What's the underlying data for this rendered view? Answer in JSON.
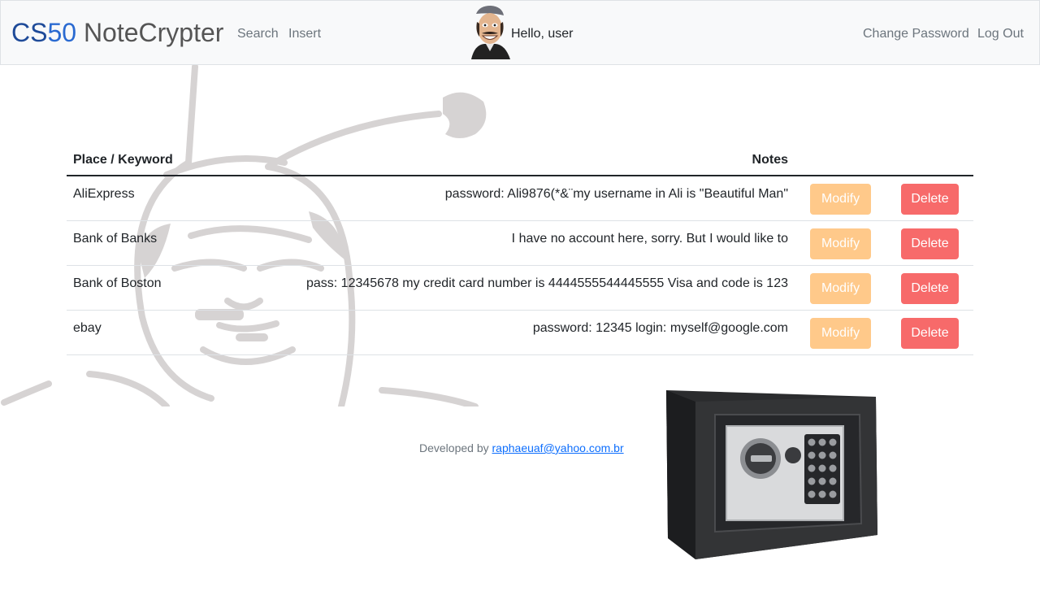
{
  "navbar": {
    "brand_cs": "CS",
    "brand_fifty": "50",
    "brand_rest": " NoteCrypter",
    "links": {
      "search": "Search",
      "insert": "Insert",
      "change_password": "Change Password",
      "logout": "Log Out"
    },
    "greeting": "Hello, user"
  },
  "table": {
    "headers": {
      "place": "Place / Keyword",
      "notes": "Notes"
    },
    "rows": [
      {
        "place": "AliExpress",
        "note": "password: Ali9876(*&¨my username in Ali is \"Beautiful Man\"",
        "modify": "Modify",
        "delete": "Delete"
      },
      {
        "place": "Bank of Banks",
        "note": "I have no account here, sorry. But I would like to",
        "modify": "Modify",
        "delete": "Delete"
      },
      {
        "place": "Bank of Boston",
        "note": "pass: 12345678 my credit card number is 4444555544445555 Visa and code is 123",
        "modify": "Modify",
        "delete": "Delete"
      },
      {
        "place": "ebay",
        "note": "password: 12345 login: myself@google.com",
        "modify": "Modify",
        "delete": "Delete"
      }
    ]
  },
  "footer": {
    "prefix": "Developed by ",
    "email": "raphaeuaf@yahoo.com.br"
  },
  "colors": {
    "modify_button": "#ffc98a",
    "delete_button": "#f76a6a",
    "navbar_bg": "#f8f9fa",
    "brand_blue": "#2a6ad1"
  },
  "icons": {
    "avatar": "caricature-avatar",
    "background": "caricature-outline",
    "safe": "safe-image"
  }
}
